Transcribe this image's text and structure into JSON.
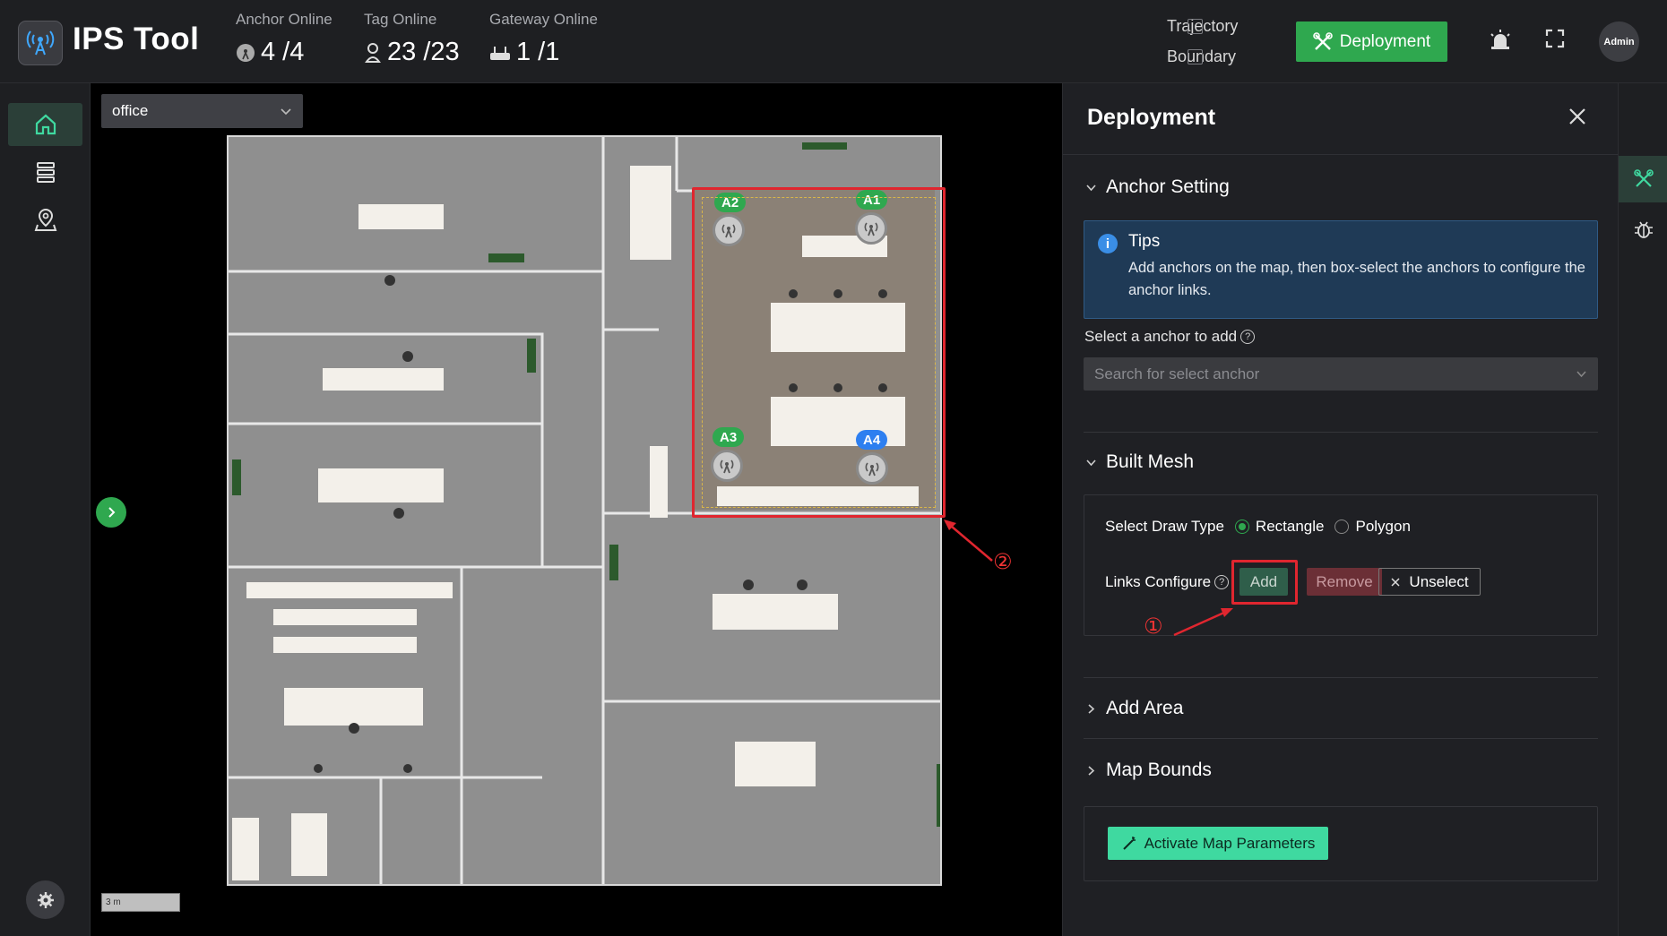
{
  "header": {
    "title": "IPS Tool",
    "stats": [
      {
        "label": "Anchor Online",
        "value": "4 /4"
      },
      {
        "label": "Tag Online",
        "value": "23 /23"
      },
      {
        "label": "Gateway Online",
        "value": "1 /1"
      }
    ],
    "trajectory_label": "Trajectory",
    "boundary_label": "Boundary",
    "deploy_label": "Deployment",
    "avatar_label": "Admin"
  },
  "map": {
    "floor": "office",
    "scale": "3 m",
    "anchors": [
      "A1",
      "A2",
      "A3",
      "A4"
    ],
    "annotation_1": "①",
    "annotation_2": "②"
  },
  "panel": {
    "title": "Deployment",
    "anchor_setting": {
      "title": "Anchor Setting",
      "tips_title": "Tips",
      "tips_text": "Add anchors on the map, then box-select the anchors to configure the anchor links.",
      "select_label": "Select a anchor to add",
      "search_placeholder": "Search for select anchor"
    },
    "built_mesh": {
      "title": "Built Mesh",
      "draw_type_label": "Select Draw Type",
      "rectangle_label": "Rectangle",
      "polygon_label": "Polygon",
      "links_label": "Links Configure",
      "add_label": "Add",
      "remove_label": "Remove",
      "unselect_label": "Unselect"
    },
    "add_area_title": "Add Area",
    "map_bounds_title": "Map Bounds",
    "activate_label": "Activate Map Parameters"
  },
  "colors": {
    "accent_green": "#2fa84f",
    "activate_button": "#3fd9a0",
    "highlight_red": "#e0262f",
    "anchor_blue": "#2d7ff0"
  }
}
